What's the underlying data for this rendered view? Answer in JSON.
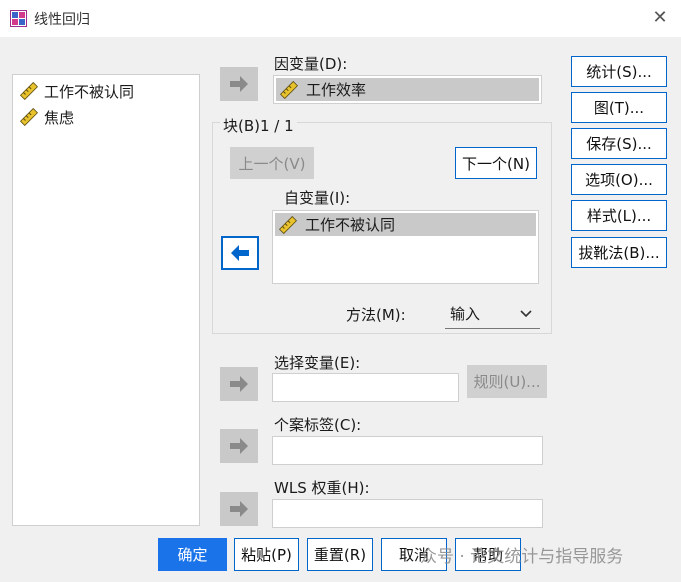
{
  "window": {
    "title": "线性回归",
    "close_symbol": "✕"
  },
  "source_vars": [
    {
      "label": "工作不被认同"
    },
    {
      "label": "焦虑"
    }
  ],
  "dependent": {
    "label": "因变量(D):",
    "value": "工作效率"
  },
  "block": {
    "label": "块(B)1 / 1",
    "prev_label": "上一个(V)",
    "next_label": "下一个(N)"
  },
  "independent": {
    "label": "自变量(I):",
    "value": "工作不被认同"
  },
  "method": {
    "label": "方法(M):",
    "value": "输入"
  },
  "selection_var": {
    "label": "选择变量(E):",
    "rule_label": "规则(U)..."
  },
  "case_label": {
    "label": "个案标签(C):"
  },
  "wls": {
    "label": "WLS 权重(H):"
  },
  "side_buttons": [
    "统计(S)...",
    "图(T)...",
    "保存(S)...",
    "选项(O)...",
    "样式(L)...",
    "拔靴法(B)..."
  ],
  "bottom_buttons": [
    "确定",
    "粘贴(P)",
    "重置(R)",
    "取消",
    "帮助"
  ],
  "watermark": "众号 · 论文统计与指导服务",
  "colors": {
    "accent": "#0066cc",
    "primary": "#1a73e8",
    "disabled": "#c9c9c9"
  }
}
